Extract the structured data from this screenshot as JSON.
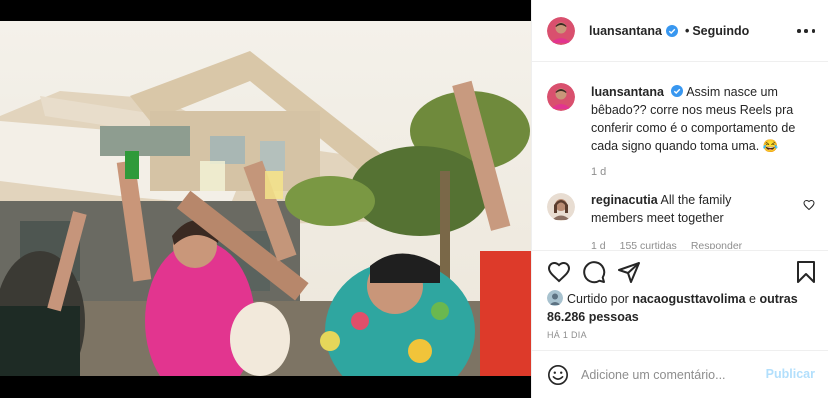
{
  "post": {
    "username": "luansantana",
    "follow_status": "Seguindo",
    "separator": "•",
    "caption": {
      "username": "luansantana",
      "text": "Assim nasce um bêbado?? corre nos meus Reels pra conferir como é o comportamento de cada signo quando toma uma. 😂",
      "time": "1 d"
    },
    "comments": [
      {
        "username": "reginacutia",
        "text": "All the family members meet together",
        "time": "1 d",
        "likes": "155 curtidas",
        "reply": "Responder"
      }
    ],
    "likes": {
      "prefix": "Curtido por",
      "first_user": "nacaogusttavolima",
      "connector": "e",
      "others": "outras 86.286 pessoas"
    },
    "date": "HÁ 1 DIA",
    "comment_box": {
      "placeholder": "Adicione um comentário...",
      "post_label": "Publicar"
    }
  },
  "icons": {
    "more": "more-options-icon",
    "verified": "verified-badge-icon",
    "like": "heart-icon",
    "comment": "comment-icon",
    "share": "share-icon",
    "save": "bookmark-icon",
    "emoji": "emoji-icon"
  },
  "colors": {
    "verified": "#3897f0",
    "text": "#262626",
    "muted": "#8e8e8e",
    "border": "#efefef",
    "post_disabled": "#b2dffc"
  }
}
